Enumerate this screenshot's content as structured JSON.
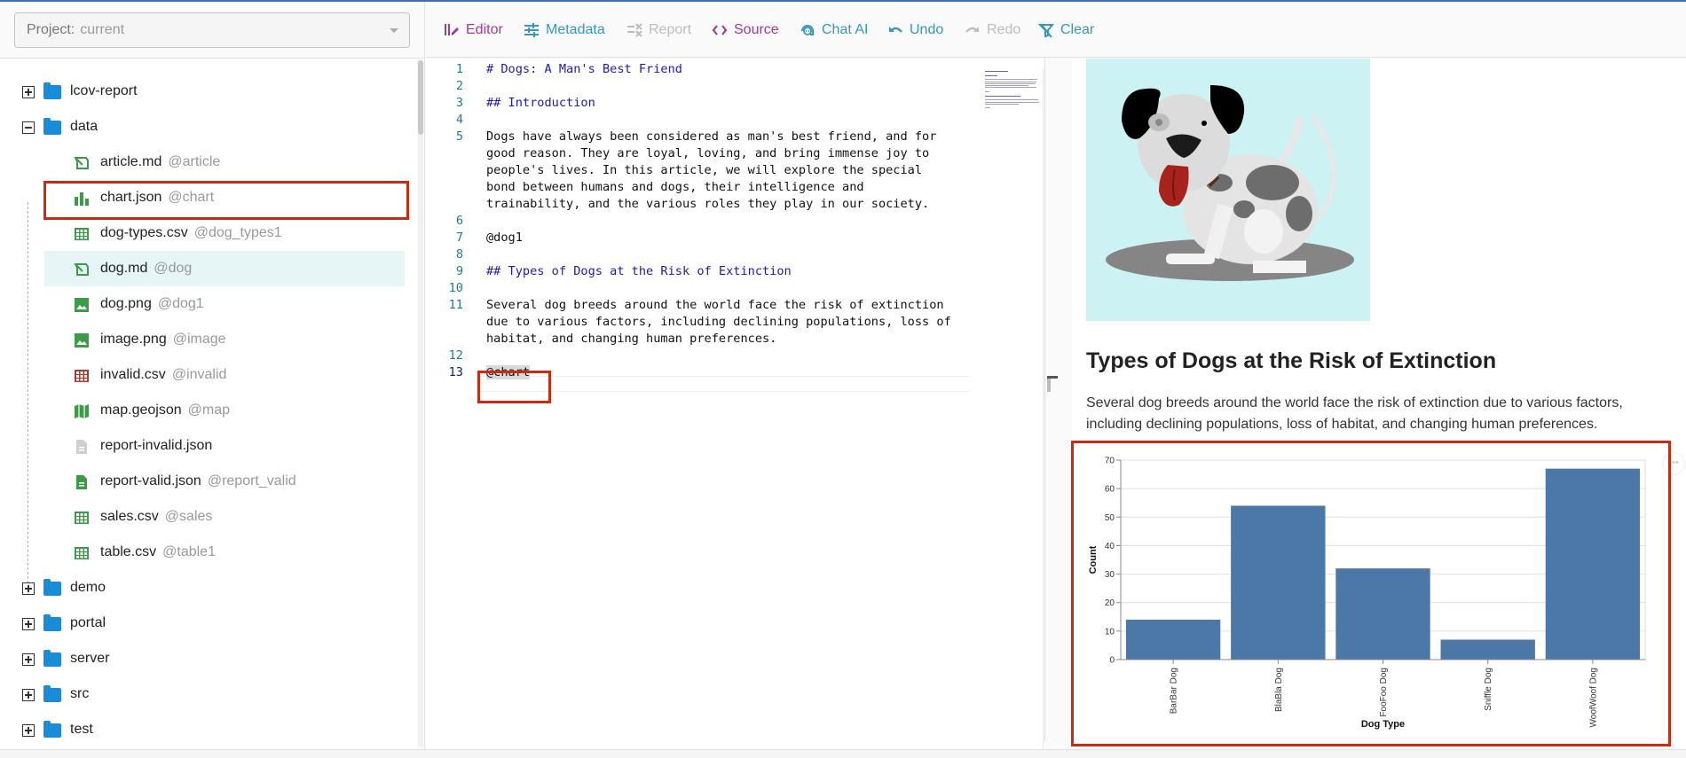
{
  "project": {
    "label": "Project:",
    "value": "current"
  },
  "tree": {
    "folders_top": [
      {
        "name": "lcov-report",
        "expanded": false
      },
      {
        "name": "data",
        "expanded": true
      }
    ],
    "files": [
      {
        "name": "article.md",
        "alias": "@article",
        "icon": "markdown-icon"
      },
      {
        "name": "chart.json",
        "alias": "@chart",
        "icon": "bar-chart-icon"
      },
      {
        "name": "dog-types.csv",
        "alias": "@dog_types1",
        "icon": "table-icon"
      },
      {
        "name": "dog.md",
        "alias": "@dog",
        "icon": "markdown-icon",
        "selected": true
      },
      {
        "name": "dog.png",
        "alias": "@dog1",
        "icon": "image-icon"
      },
      {
        "name": "image.png",
        "alias": "@image",
        "icon": "image-icon"
      },
      {
        "name": "invalid.csv",
        "alias": "@invalid",
        "icon": "table-invalid-icon"
      },
      {
        "name": "map.geojson",
        "alias": "@map",
        "icon": "map-icon"
      },
      {
        "name": "report-invalid.json",
        "alias": "",
        "icon": "report-invalid-icon"
      },
      {
        "name": "report-valid.json",
        "alias": "@report_valid",
        "icon": "report-valid-icon"
      },
      {
        "name": "sales.csv",
        "alias": "@sales",
        "icon": "table-icon"
      },
      {
        "name": "table.csv",
        "alias": "@table1",
        "icon": "table-icon"
      }
    ],
    "folders_bottom": [
      {
        "name": "demo"
      },
      {
        "name": "portal"
      },
      {
        "name": "server"
      },
      {
        "name": "src"
      },
      {
        "name": "test"
      }
    ]
  },
  "toolbar": {
    "editor": "Editor",
    "metadata": "Metadata",
    "report": "Report",
    "source": "Source",
    "chat_ai": "Chat AI",
    "undo": "Undo",
    "redo": "Redo",
    "clear": "Clear"
  },
  "editor": {
    "lines": [
      {
        "n": "1",
        "text": "# Dogs: A Man's Best Friend",
        "heading": true
      },
      {
        "n": "2",
        "text": ""
      },
      {
        "n": "3",
        "text": "## Introduction",
        "heading": true
      },
      {
        "n": "4",
        "text": ""
      },
      {
        "n": "5",
        "text": "Dogs have always been considered as man's best friend, and for"
      },
      {
        "n": "",
        "text": "good reason. They are loyal, loving, and bring immense joy to"
      },
      {
        "n": "",
        "text": "people's lives. In this article, we will explore the special"
      },
      {
        "n": "",
        "text": "bond between humans and dogs, their intelligence and"
      },
      {
        "n": "",
        "text": "trainability, and the various roles they play in our society."
      },
      {
        "n": "6",
        "text": ""
      },
      {
        "n": "7",
        "text": "@dog1"
      },
      {
        "n": "8",
        "text": ""
      },
      {
        "n": "9",
        "text": "## Types of Dogs at the Risk of Extinction",
        "heading": true
      },
      {
        "n": "10",
        "text": ""
      },
      {
        "n": "11",
        "text": "Several dog breeds around the world face the risk of extinction"
      },
      {
        "n": "",
        "text": "due to various factors, including declining populations, loss of"
      },
      {
        "n": "",
        "text": "habitat, and changing human preferences."
      },
      {
        "n": "12",
        "text": ""
      },
      {
        "n": "13",
        "text": "@chart",
        "current": true
      }
    ]
  },
  "preview": {
    "heading": "Types of Dogs at the Risk of Extinction",
    "paragraph": "Several dog breeds around the world face the risk of extinction due to various factors, including declining populations, loss of habitat, and changing human preferences.",
    "chart_menu": "•••"
  },
  "colors": {
    "accent_purple": "#9c3d96",
    "accent_teal": "#3797b8",
    "highlight_red": "#c72c12",
    "bar": "#4c78a8",
    "folder": "#1a8bd6",
    "file_green": "#3d9a48"
  },
  "chart_data": {
    "type": "bar",
    "title": "",
    "xlabel": "Dog Type",
    "ylabel": "Count",
    "categories": [
      "BarBar Dog",
      "BlaBla Dog",
      "FooFoo Dog",
      "Sniffle Dog",
      "WoofWoof Dog"
    ],
    "values": [
      14,
      54,
      32,
      7,
      67
    ],
    "ylim": [
      0,
      70
    ],
    "yticks": [
      0,
      10,
      20,
      30,
      40,
      50,
      60,
      70
    ],
    "grid": true
  }
}
